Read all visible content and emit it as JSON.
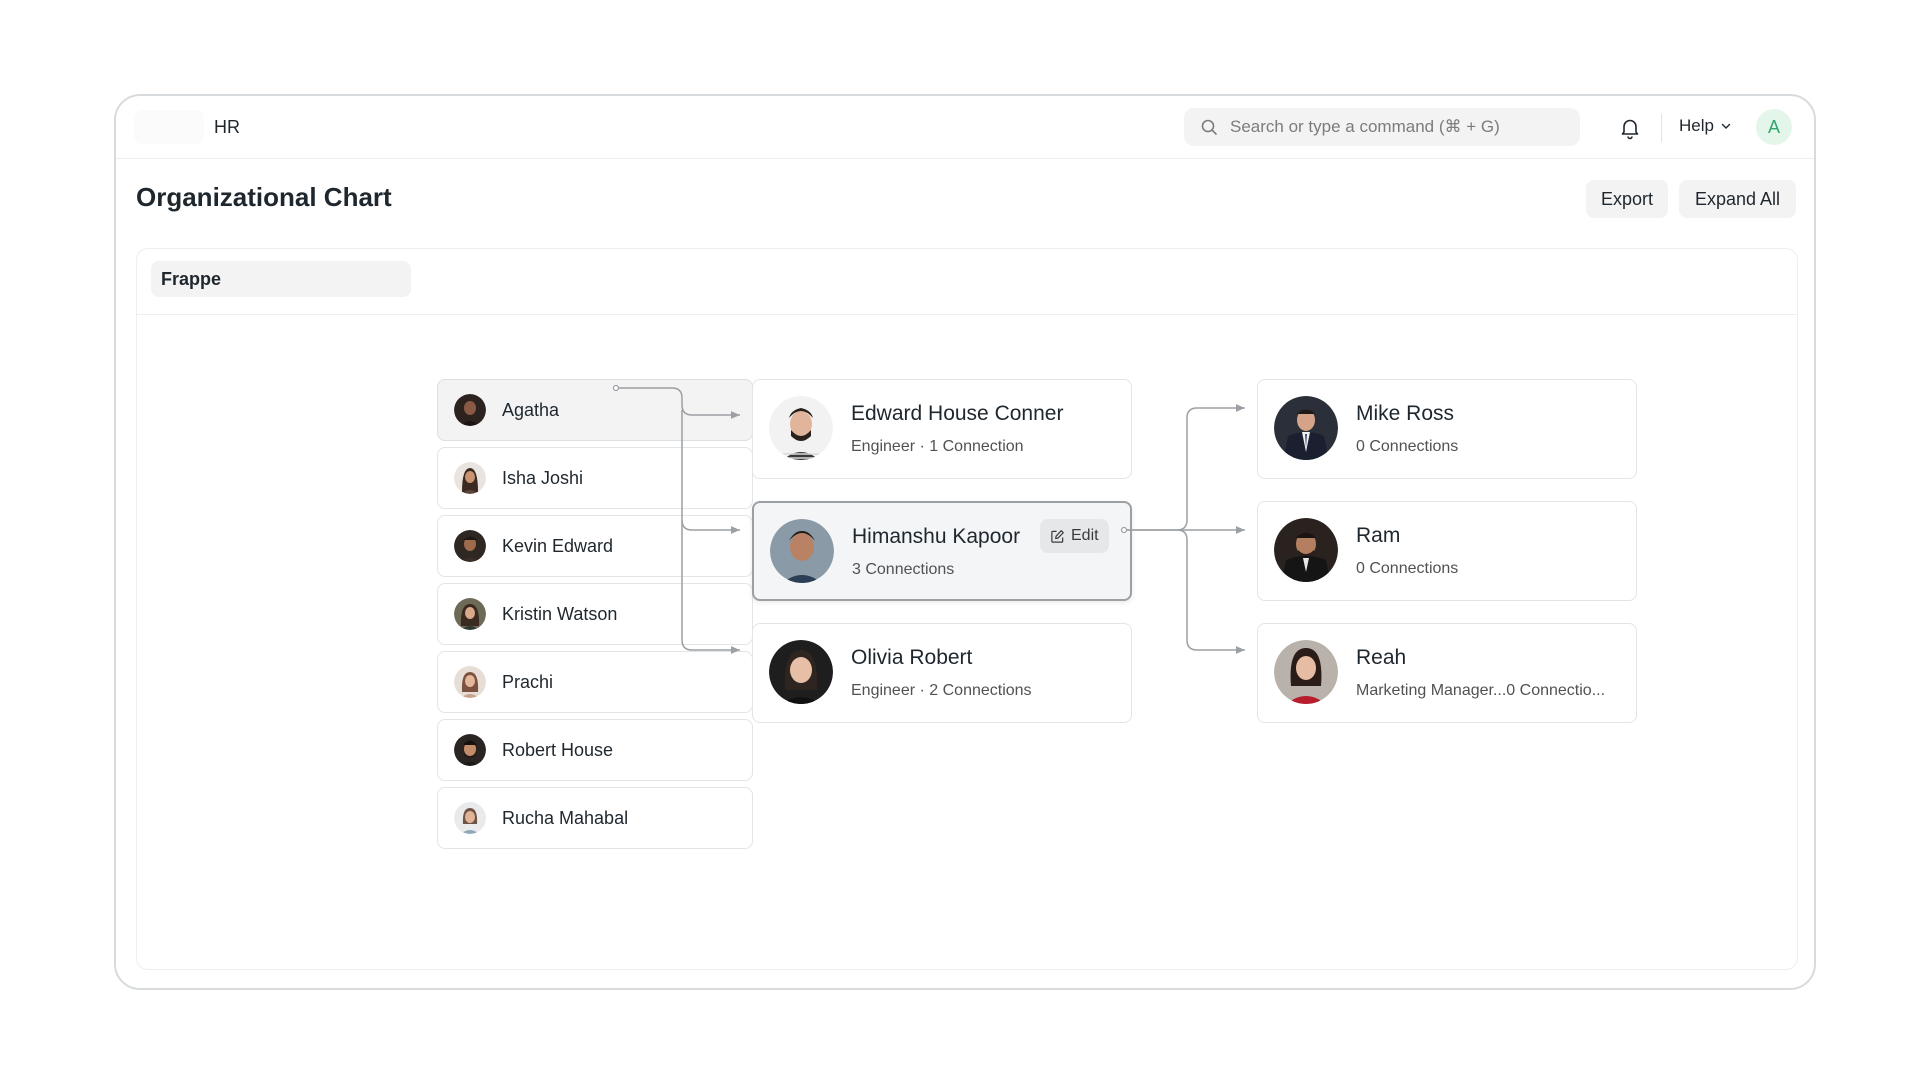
{
  "navbar": {
    "app_title": "HR",
    "search_placeholder": "Search or type a command (⌘ + G)",
    "help_label": "Help",
    "avatar_initial": "A"
  },
  "page": {
    "title": "Organizational Chart",
    "export_label": "Export",
    "expand_all_label": "Expand All"
  },
  "company": "Frappe",
  "employees": [
    {
      "name": "Agatha",
      "active": true
    },
    {
      "name": "Isha Joshi"
    },
    {
      "name": "Kevin Edward"
    },
    {
      "name": "Kristin Watson"
    },
    {
      "name": "Prachi"
    },
    {
      "name": "Robert House"
    },
    {
      "name": "Rucha Mahabal"
    }
  ],
  "level2": [
    {
      "name": "Edward House Conner",
      "subtitle": "Engineer · 1 Connection"
    },
    {
      "name": "Himanshu Kapoor",
      "subtitle": "3 Connections",
      "active": true,
      "edit_label": "Edit"
    },
    {
      "name": "Olivia Robert",
      "subtitle": "Engineer · 2 Connections"
    }
  ],
  "level3": [
    {
      "name": "Mike Ross",
      "subtitle": "0 Connections"
    },
    {
      "name": "Ram",
      "subtitle": "0 Connections"
    },
    {
      "name": "Reah",
      "subtitle": "Marketing Manager...0 Connectio..."
    }
  ],
  "colors": {
    "accent_green": "#30a66d",
    "connector": "#9ca0a4"
  }
}
